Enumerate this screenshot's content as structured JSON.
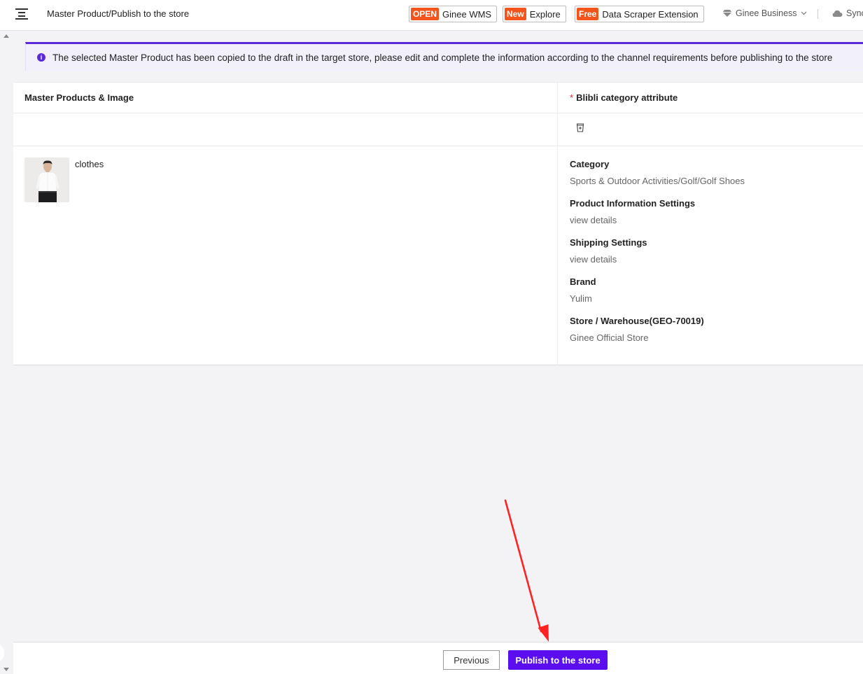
{
  "header": {
    "breadcrumb": "Master Product/Publish to the store",
    "promos": [
      {
        "tag": "OPEN",
        "label": "Ginee WMS"
      },
      {
        "tag": "New",
        "label": "Explore"
      },
      {
        "tag": "Free",
        "label": "Data Scraper Extension"
      }
    ],
    "business_label": "Ginee Business",
    "sync_label": "Sync"
  },
  "notice": {
    "text": "The selected Master Product has been copied to the draft in the target store, please edit and complete the information according to the channel requirements before publishing to the store"
  },
  "table": {
    "left_header": "Master Products & Image",
    "right_header": "Blibli category attribute",
    "required_mark": "*",
    "product": {
      "name": "clothes"
    },
    "attributes": [
      {
        "label": "Category",
        "value": "Sports & Outdoor Activities/Golf/Golf Shoes",
        "link": false
      },
      {
        "label": "Product Information Settings",
        "value": "view details",
        "link": true
      },
      {
        "label": "Shipping Settings",
        "value": "view details",
        "link": true
      },
      {
        "label": "Brand",
        "value": "Yulim",
        "link": false
      },
      {
        "label": "Store / Warehouse(GEO-70019)",
        "value": "Ginee Official Store",
        "link": false
      }
    ]
  },
  "footer": {
    "previous_label": "Previous",
    "publish_label": "Publish to the store"
  },
  "colors": {
    "accent": "#5b0ff0",
    "promo_tag": "#f2541b",
    "annotation_arrow": "#ff2222"
  }
}
